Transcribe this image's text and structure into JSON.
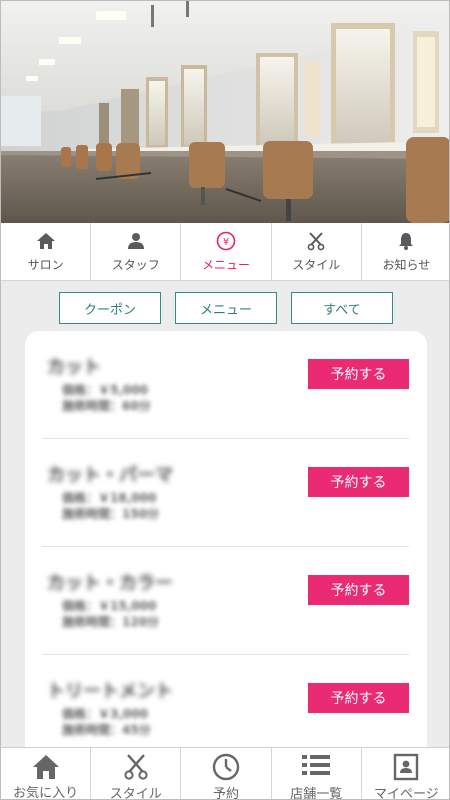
{
  "top_nav": [
    {
      "label": "サロン",
      "icon": "home-icon"
    },
    {
      "label": "スタッフ",
      "icon": "person-icon"
    },
    {
      "label": "メニュー",
      "icon": "yen-icon",
      "active": true
    },
    {
      "label": "スタイル",
      "icon": "scissors-icon"
    },
    {
      "label": "お知らせ",
      "icon": "bell-icon"
    }
  ],
  "filters": [
    {
      "label": "クーポン"
    },
    {
      "label": "メニュー"
    },
    {
      "label": "すべて"
    }
  ],
  "menu_items": [
    {
      "name": "カット",
      "price": "価格：￥5,000",
      "duration": "施術時間：60分",
      "button": "予約する"
    },
    {
      "name": "カット・パーマ",
      "price": "価格：￥18,000",
      "duration": "施術時間：150分",
      "button": "予約する"
    },
    {
      "name": "カット・カラー",
      "price": "価格：￥15,000",
      "duration": "施術時間：120分",
      "button": "予約する"
    },
    {
      "name": "トリートメント",
      "price": "価格：￥3,000",
      "duration": "施術時間：45分",
      "button": "予約する"
    }
  ],
  "bottom_tabs": [
    {
      "label": "お気に入り",
      "icon": "home-icon"
    },
    {
      "label": "スタイル",
      "icon": "scissors-icon"
    },
    {
      "label": "予約",
      "icon": "clock-icon"
    },
    {
      "label": "店舗一覧",
      "icon": "list-icon"
    },
    {
      "label": "マイページ",
      "icon": "profile-card-icon"
    }
  ],
  "colors": {
    "accent": "#e8206f",
    "teal": "#2f8a8c",
    "reserve_button": "#ea2a72"
  }
}
